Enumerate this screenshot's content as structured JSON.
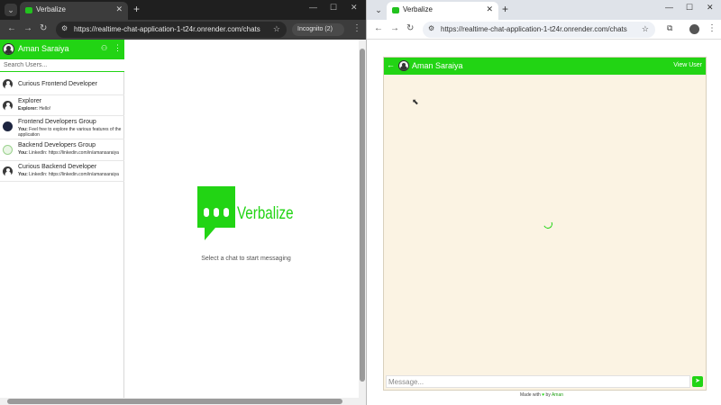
{
  "left_window": {
    "tab_title": "Verbalize",
    "url": "https://realtime-chat-application-1-t24r.onrender.com/chats",
    "incognito_label": "Incognito (2)",
    "sidebar": {
      "user_name": "Aman Saraiya",
      "search_placeholder": "Search Users...",
      "chats": [
        {
          "name": "Curious Frontend Developer",
          "sender": "",
          "preview": ""
        },
        {
          "name": "Explorer",
          "sender": "Explorer:",
          "preview": "Hello!"
        },
        {
          "name": "Frontend Developers Group",
          "sender": "You:",
          "preview": "Feel free to explore the various features of the application"
        },
        {
          "name": "Backend Developers Group",
          "sender": "You:",
          "preview": "LinkedIn: https://linkedin.com/in/amansaraiya"
        },
        {
          "name": "Curious Backend Developer",
          "sender": "You:",
          "preview": "LinkedIn: https://linkedin.com/in/amansaraiya"
        }
      ]
    },
    "main": {
      "logo_text": "Verbalize",
      "hint": "Select a chat to start messaging"
    }
  },
  "right_window": {
    "tab_title": "Verbalize",
    "url": "https://realtime-chat-application-1-t24r.onrender.com/chats",
    "chat_header": {
      "user_name": "Aman Saraiya",
      "view_user_label": "View User"
    },
    "message_placeholder": "Message...",
    "footer": {
      "made_with": "Made with",
      "by": "by",
      "author": "Aman"
    }
  },
  "colors": {
    "brand_green": "#22d414",
    "chat_background": "#fbf3e3"
  }
}
